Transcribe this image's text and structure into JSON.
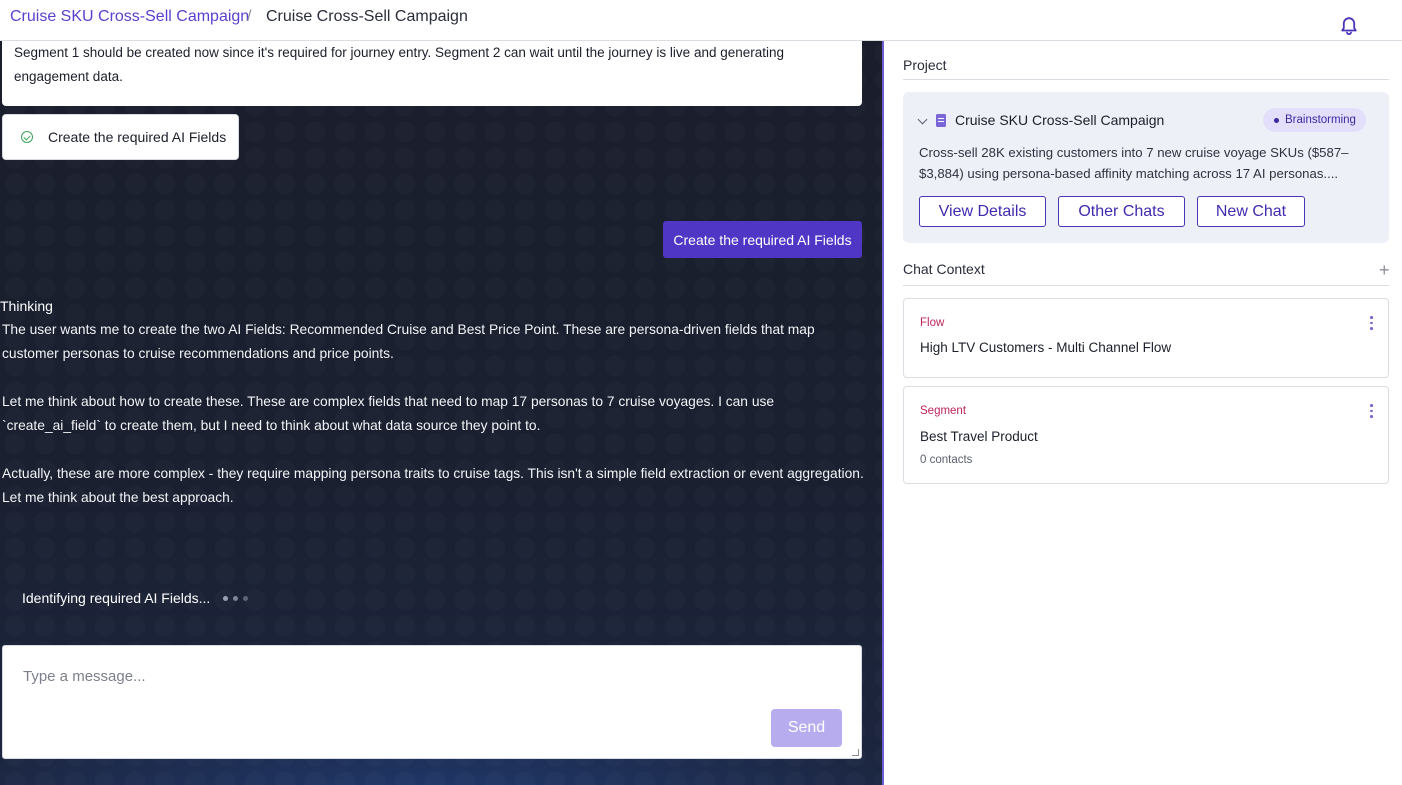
{
  "header": {
    "breadcrumb_link": "Cruise SKU Cross-Sell Campaign",
    "separator": "/",
    "breadcrumb_current": "Cruise Cross-Sell Campaign"
  },
  "chat": {
    "assistant_message_tail": "Segment 1 should be created now since it's required for journey entry. Segment 2 can wait until the journey is live and generating engagement data.",
    "completed_task": "Create the required AI Fields",
    "user_message": "Create the required AI Fields",
    "thinking_label": "Thinking",
    "thinking_paragraphs": [
      "The user wants me to create the two AI Fields: Recommended Cruise and Best Price Point. These are persona-driven fields that map customer personas to cruise recommendations and price points.",
      "Let me think about how to create these. These are complex fields that need to map 17 personas to 7 cruise voyages. I can use `create_ai_field` to create them, but I need to think about what data source they point to.",
      "Actually, these are more complex - they require mapping persona traits to cruise tags. This isn't a simple field extraction or event aggregation. Let me think about the best approach."
    ],
    "status_text": "Identifying required AI Fields...",
    "composer_placeholder": "Type a message...",
    "send_label": "Send"
  },
  "sidebar": {
    "project_section_title": "Project",
    "project": {
      "name": "Cruise SKU Cross-Sell Campaign",
      "status": "Brainstorming",
      "description": "Cross-sell 28K existing customers into 7 new cruise voyage SKUs ($587–$3,884) using persona-based affinity matching across 17 AI personas....",
      "buttons": [
        "View Details",
        "Other Chats",
        "New Chat"
      ]
    },
    "context_section_title": "Chat Context",
    "context_items": [
      {
        "type": "Flow",
        "name": "High LTV Customers - Multi Channel Flow"
      },
      {
        "type": "Segment",
        "name": "Best Travel Product",
        "sub": "0 contacts"
      }
    ]
  },
  "colors": {
    "accent": "#5036c4",
    "send_disabled": "#b7acee",
    "context_type": "#c0245c",
    "badge_bg": "#e3dffa",
    "chat_bg": "#1a1e2c"
  }
}
